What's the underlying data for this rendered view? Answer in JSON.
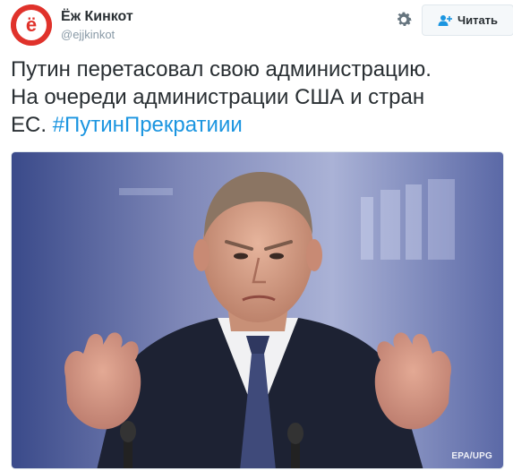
{
  "author": {
    "name": "Ёж Кинкот",
    "handle": "@ejjkinkot",
    "avatar_letter": "ё"
  },
  "actions": {
    "follow_label": "Читать"
  },
  "tweet": {
    "text_line1": "Путин перетасовал свою администрацию.",
    "text_line2": "На очереди администрации США и стран",
    "text_line3": "ЕС. ",
    "hashtag": "#ПутинПрекратиии"
  },
  "media": {
    "credit": "EPA/UPG"
  },
  "colors": {
    "avatar_red": "#e0322b",
    "hashtag_blue": "#1b95e0",
    "handle_gray": "#8899a6",
    "text": "#292f33"
  },
  "icons": [
    "gear-icon",
    "follow-person-icon"
  ]
}
